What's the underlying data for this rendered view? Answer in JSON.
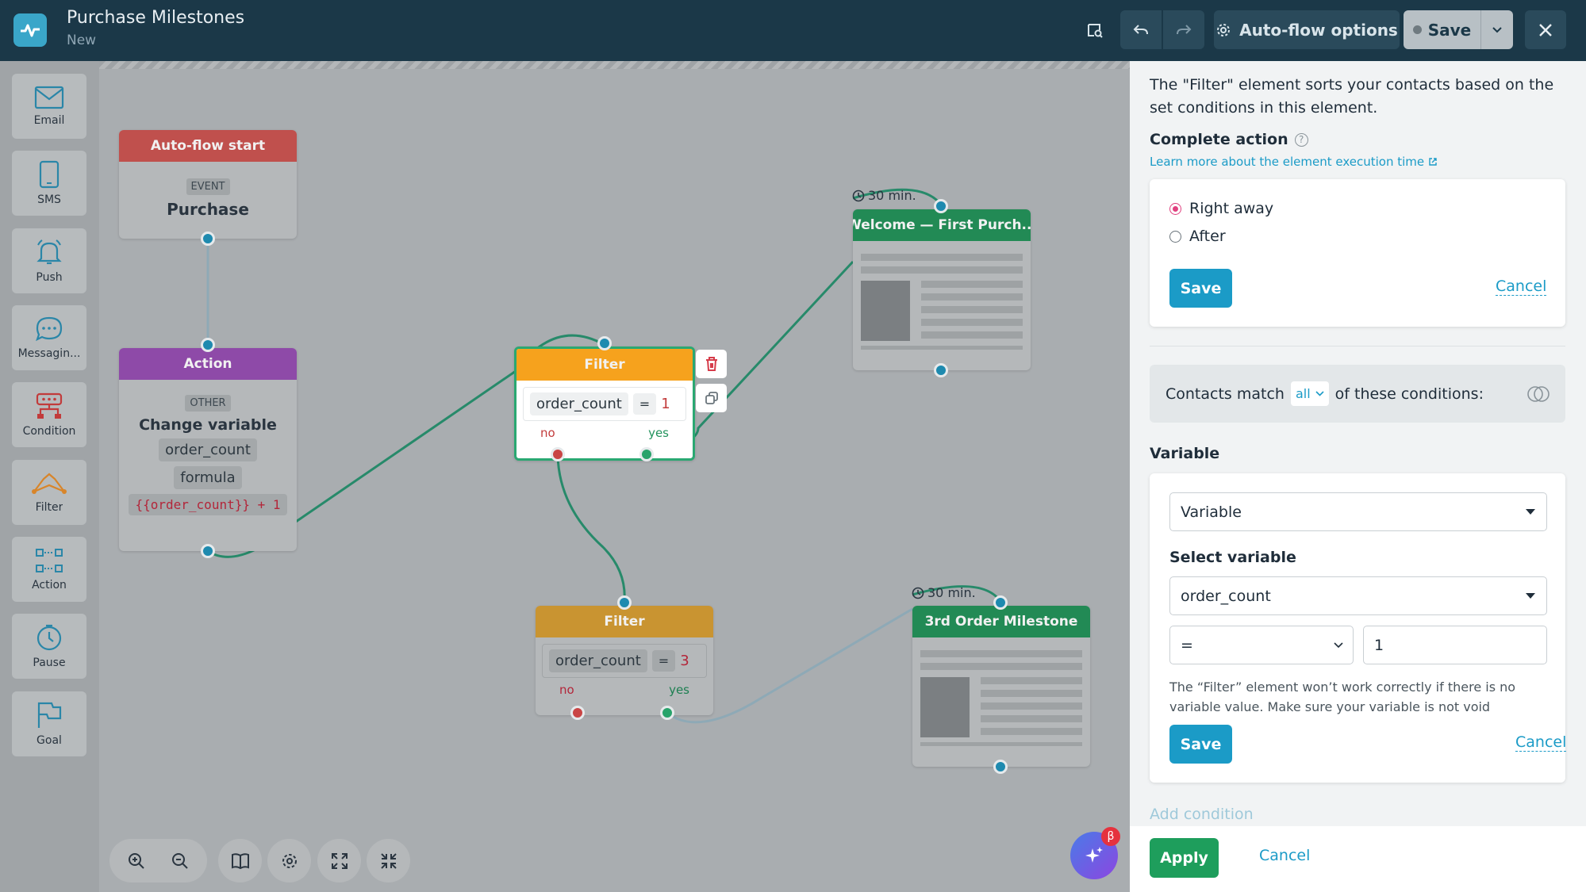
{
  "header": {
    "title": "Purchase Milestones",
    "subtitle": "New",
    "autoflow_options": "Auto-flow options",
    "save": "Save"
  },
  "sidebar": {
    "items": [
      {
        "label": "Email",
        "icon": "envelope-icon"
      },
      {
        "label": "SMS",
        "icon": "phone-icon"
      },
      {
        "label": "Push",
        "icon": "bell-icon"
      },
      {
        "label": "Messagin...",
        "icon": "chat-icon"
      },
      {
        "label": "Condition",
        "icon": "condition-icon"
      },
      {
        "label": "Filter",
        "icon": "filter-icon"
      },
      {
        "label": "Action",
        "icon": "action-icon"
      },
      {
        "label": "Pause",
        "icon": "clock-icon"
      },
      {
        "label": "Goal",
        "icon": "flag-icon"
      }
    ]
  },
  "nodes": {
    "start": {
      "title": "Auto-flow start",
      "tag": "EVENT",
      "event": "Purchase"
    },
    "action": {
      "title": "Action",
      "tag": "OTHER",
      "name": "Change variable",
      "variable": "order_count",
      "mode": "formula",
      "expression": "{{order_count}} + 1"
    },
    "filter1": {
      "title": "Filter",
      "variable": "order_count",
      "op": "=",
      "value": "1",
      "no": "no",
      "yes": "yes"
    },
    "filter2": {
      "title": "Filter",
      "variable": "order_count",
      "op": "=",
      "value": "3",
      "no": "no",
      "yes": "yes"
    },
    "email1": {
      "title": "Welcome — First Purch...",
      "delay": "30 min."
    },
    "email2": {
      "title": "3rd Order Milestone",
      "delay": "30 min."
    }
  },
  "assistant_badge": "β",
  "panel": {
    "description": "The \"Filter\" element sorts your contacts based on the set conditions in this element.",
    "complete_action": "Complete action",
    "learn_more": "Learn more about the element execution time",
    "radio_right_away": "Right away",
    "radio_after": "After",
    "save": "Save",
    "cancel": "Cancel",
    "contacts_match_prefix": "Contacts match",
    "contacts_match_value": "all",
    "contacts_match_suffix": "of these conditions:",
    "variable_heading": "Variable",
    "variable_select": "Variable",
    "select_variable_label": "Select variable",
    "selected_variable": "order_count",
    "operator": "=",
    "value": "1",
    "warning": "The “Filter” element won’t work correctly if there is no variable value. Make sure your variable is not void",
    "add_condition": "Add condition",
    "apply": "Apply",
    "cancel_bottom": "Cancel"
  },
  "colors": {
    "topbar": "#1b3848",
    "start_head": "#c0504d",
    "action_head": "#8e4aa8",
    "filter_active": "#f6a21d",
    "filter_head": "#c99431",
    "email_head": "#228a55",
    "accent": "#1b9bc7",
    "apply": "#1e9e5c"
  }
}
